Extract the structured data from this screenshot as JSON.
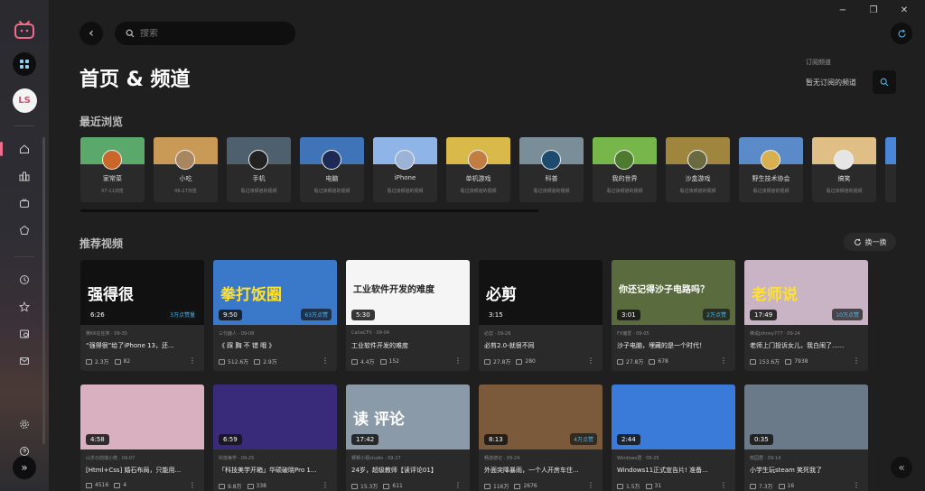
{
  "search": {
    "placeholder": "搜索"
  },
  "sidebar": {
    "avatar_initials": "LS",
    "items": [
      {
        "name": "home-icon"
      },
      {
        "name": "partitions-icon"
      },
      {
        "name": "live-icon"
      },
      {
        "name": "dynamics-icon"
      },
      {
        "name": "history-icon"
      },
      {
        "name": "favorites-icon"
      },
      {
        "name": "later-icon"
      },
      {
        "name": "message-icon"
      },
      {
        "name": "settings-icon"
      },
      {
        "name": "help-icon"
      }
    ]
  },
  "window": {
    "minimize": "−",
    "restore": "❐",
    "close": "✕"
  },
  "header": {
    "title": "首页 & 频道"
  },
  "subscriptions": {
    "label": "订阅频道",
    "empty_text": "暂无订阅的频道"
  },
  "recent": {
    "title": "最近浏览",
    "items": [
      {
        "name": "家常菜",
        "desc": "07-11浏览",
        "bg": "#5aa86a",
        "av": "#c9662a"
      },
      {
        "name": "小吃",
        "desc": "06-27浏览",
        "bg": "#c99a56",
        "av": "#a88760"
      },
      {
        "name": "手机",
        "desc": "看过该频道的视频",
        "bg": "#4e5f6e",
        "av": "#222222"
      },
      {
        "name": "电脑",
        "desc": "看过该频道的视频",
        "bg": "#3f74b8",
        "av": "#1d2a55"
      },
      {
        "name": "iPhone",
        "desc": "看过该频道的视频",
        "bg": "#8fb4e8",
        "av": "#9ab3d6"
      },
      {
        "name": "单机游戏",
        "desc": "看过该频道的视频",
        "bg": "#d8b94a",
        "av": "#c27d42"
      },
      {
        "name": "科普",
        "desc": "看过该频道的视频",
        "bg": "#7a8e9a",
        "av": "#1d4a6e"
      },
      {
        "name": "我的世界",
        "desc": "看过该频道的视频",
        "bg": "#76b64a",
        "av": "#4c7a2e"
      },
      {
        "name": "沙盒游戏",
        "desc": "看过该频道的视频",
        "bg": "#a0853e",
        "av": "#6a6a40"
      },
      {
        "name": "野生技术协会",
        "desc": "看过该频道的视频",
        "bg": "#5a8ac8",
        "av": "#d8b050"
      },
      {
        "name": "搞笑",
        "desc": "看过该频道的视频",
        "bg": "#e0bf86",
        "av": "#e5e5e5"
      },
      {
        "name": "",
        "desc": "看过",
        "bg": "#4a86d8",
        "av": "#3a6ab8"
      }
    ]
  },
  "recommend": {
    "title": "推荐视频",
    "shuffle_label": "换一换",
    "row1": [
      {
        "duration": "6:26",
        "views_badge": "3万点赞量",
        "meta": "黄KK在狂笑 · 09-30",
        "title": "“强得很”给了iPhone 13，还...",
        "stat1": "2.3万",
        "stat2": "82",
        "bg": "#111111",
        "txt": "强得很",
        "txtc": "#ffffff"
      },
      {
        "duration": "9:50",
        "views_badge": "63万点赞",
        "meta": "三代鹿人 · 09-08",
        "title": "《 踩 胸 不 错 哦 》",
        "stat1": "512.6万",
        "stat2": "2.9万",
        "bg": "#3a78c9",
        "txt": "拳打饭圈",
        "txtc": "#ffe12e"
      },
      {
        "duration": "5:30",
        "views_badge": "",
        "meta": "CatiaCFX · 09-04",
        "title": "工业软件开发的难度",
        "stat1": "4.4万",
        "stat2": "152",
        "bg": "#f5f5f5",
        "txt": "工业软件开发的难度",
        "txtc": "#222222"
      },
      {
        "duration": "3:15",
        "views_badge": "",
        "meta": "必剪 · 09-28",
        "title": "必剪2.0-就很不同",
        "stat1": "27.8万",
        "stat2": "280",
        "bg": "#121212",
        "txt": "必剪",
        "txtc": "#ffffff"
      },
      {
        "duration": "3:01",
        "views_badge": "2万点赞",
        "meta": "FX偏爱 · 09-05",
        "title": "沙子电脑，埋藏的是一个时代！",
        "stat1": "27.8万",
        "stat2": "678",
        "bg": "#5a6b3e",
        "txt": "你还记得沙子电路吗？",
        "txtc": "#ffffff"
      },
      {
        "duration": "17:49",
        "views_badge": "10万点赞",
        "meta": "佛说Johnny777 · 09-24",
        "title": "老师上门投诉女儿，我白闹了......",
        "stat1": "153.6万",
        "stat2": "7938",
        "bg": "#c8b4c4",
        "txt": "老师说",
        "txtc": "#ffe12e"
      }
    ],
    "row2": [
      {
        "duration": "4:58",
        "views_badge": "",
        "meta": "山羊の前端小窝 · 09-07",
        "title": "[Html+Css] 婚石布局，只能用...",
        "stat1": "4516",
        "stat2": "4",
        "bg": "#d8b0c0",
        "txt": "",
        "txtc": "#ffffff"
      },
      {
        "duration": "6:59",
        "views_badge": "",
        "meta": "科技美学 · 09-25",
        "title": "「科技美学开箱」华硕破晓Pro 1...",
        "stat1": "9.8万",
        "stat2": "338",
        "bg": "#3a2a7a",
        "txt": "",
        "txtc": "#ffffff"
      },
      {
        "duration": "17:42",
        "views_badge": "",
        "meta": "狮狮小视studio · 09-27",
        "title": "24岁，超级教师【读评论01】",
        "stat1": "15.3万",
        "stat2": "611",
        "bg": "#8a9aa8",
        "txt": "读 评论",
        "txtc": "#ffffff"
      },
      {
        "duration": "8:13",
        "views_badge": "4万点赞",
        "meta": "畅游游记 · 09-24",
        "title": "外面突降暴雨，一个人开房车住...",
        "stat1": "116万",
        "stat2": "2676",
        "bg": "#7a5a3a",
        "txt": "",
        "txtc": "#ffffff"
      },
      {
        "duration": "2:44",
        "views_badge": "",
        "meta": "Windows君 · 09-25",
        "title": "Windows11正式宣告片! 准备...",
        "stat1": "1.5万",
        "stat2": "31",
        "bg": "#3a7ad8",
        "txt": "",
        "txtc": "#ffffff"
      },
      {
        "duration": "0:35",
        "views_badge": "",
        "meta": "校园君 · 09-14",
        "title": "小学生玩steam 笑死我了",
        "stat1": "7.3万",
        "stat2": "16",
        "bg": "#6a7a88",
        "txt": "",
        "txtc": "#ffffff"
      }
    ]
  },
  "colors": {
    "accent": "#f06c8c",
    "badge_blue": "#4fb3e8"
  }
}
